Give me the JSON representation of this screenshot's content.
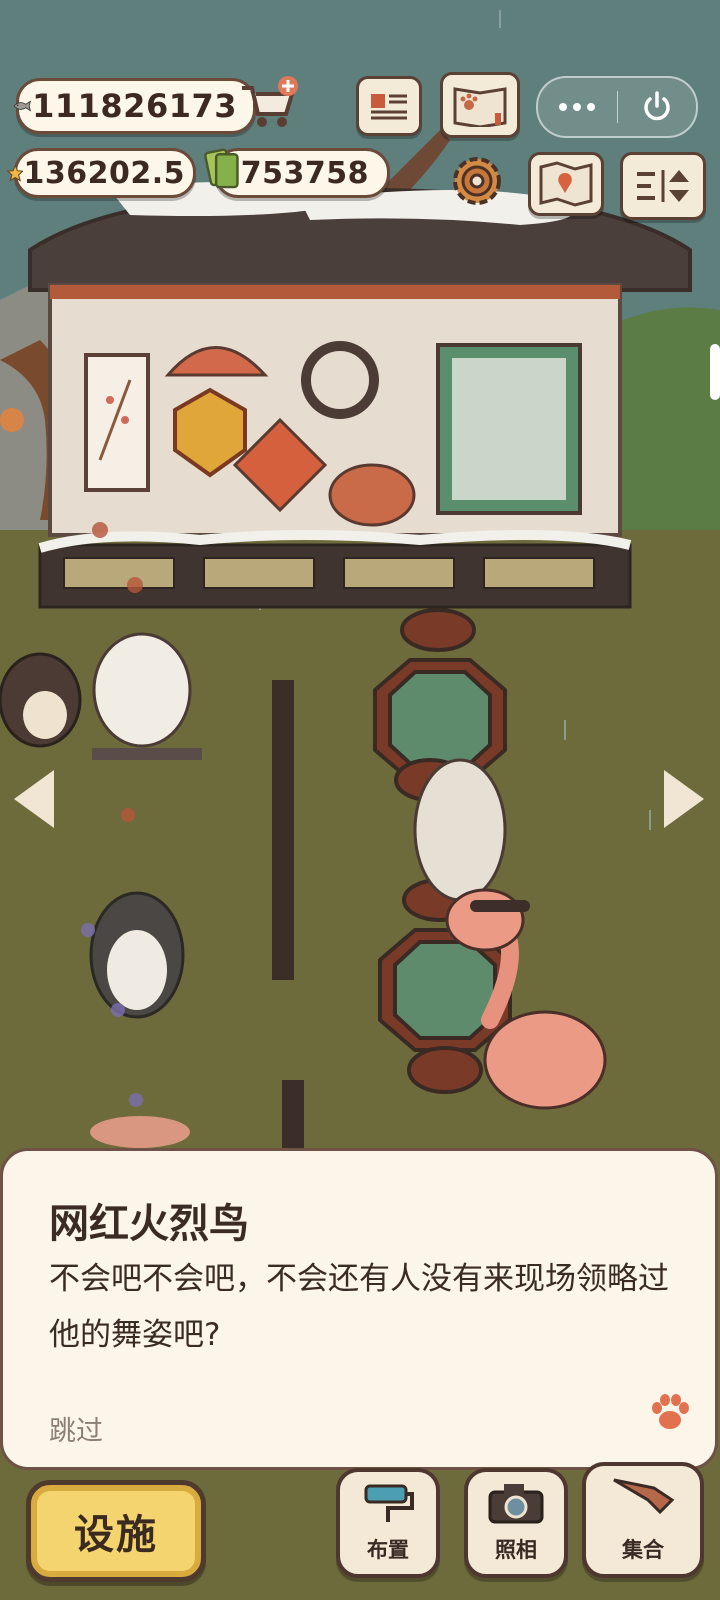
{
  "currencies": {
    "fish": "111826173",
    "star": "136202.5",
    "ticket": "753758"
  },
  "icons": {
    "fish": "fish-icon",
    "cart": "shop-cart-icon",
    "star": "star-coin-icon",
    "ticket": "ticket-icon",
    "newspaper": "newspaper-icon",
    "album": "paw-album-icon",
    "settings": "gear-icon",
    "map": "map-icon",
    "sort": "sort-toggle-icon",
    "more": "more-dots-icon",
    "close": "power-icon",
    "paw": "paw-icon"
  },
  "dialog": {
    "speaker": "网红火烈鸟",
    "line": "不会吧不会吧，不会还有人没有来现场领略过他的舞姿吧?",
    "skip": "跳过"
  },
  "bottom_bar": {
    "facilities": "设施",
    "arrange": "布置",
    "photo": "照相",
    "gather": "集合"
  },
  "colors": {
    "sky": "#5f7f7c",
    "grass": "#6d6a3c",
    "panel": "#fbf5ea",
    "border": "#6e5246",
    "accent": "#e2714f",
    "facilities_button": "#f4d46e"
  }
}
